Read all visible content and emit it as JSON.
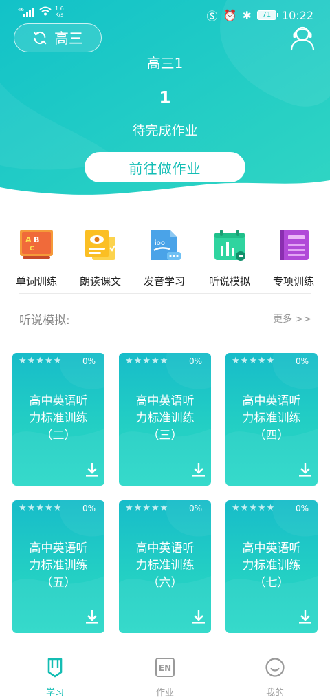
{
  "status_bar": {
    "signal": "46",
    "net_speed_value": "1.6",
    "net_speed_unit": "K/s",
    "battery": "71",
    "time": "10:22"
  },
  "header": {
    "grade_button_label": "高三",
    "class_name": "高三1",
    "pending_count": "1",
    "pending_label": "待完成作业",
    "go_button_label": "前往做作业"
  },
  "features": [
    {
      "label": "单词训练",
      "icon": "abc-board-icon"
    },
    {
      "label": "朗读课文",
      "icon": "reading-book-icon"
    },
    {
      "label": "发音学习",
      "icon": "pronunciation-doc-icon"
    },
    {
      "label": "听说模拟",
      "icon": "calendar-chart-icon"
    },
    {
      "label": "专项训练",
      "icon": "purple-book-icon"
    }
  ],
  "section": {
    "title": "听说模拟:",
    "more": "更多 >>"
  },
  "cards": [
    {
      "title": "高中英语听力标准训练（二）",
      "line1": "高中英语听",
      "line2": "力标准训练",
      "line3": "（二）",
      "progress": "0%"
    },
    {
      "title": "高中英语听力标准训练（三）",
      "line1": "高中英语听",
      "line2": "力标准训练",
      "line3": "（三）",
      "progress": "0%"
    },
    {
      "title": "高中英语听力标准训练（四）",
      "line1": "高中英语听",
      "line2": "力标准训练",
      "line3": "（四）",
      "progress": "0%"
    },
    {
      "title": "高中英语听力标准训练（五）",
      "line1": "高中英语听",
      "line2": "力标准训练",
      "line3": "（五）",
      "progress": "0%"
    },
    {
      "title": "高中英语听力标准训练（六）",
      "line1": "高中英语听",
      "line2": "力标准训练",
      "line3": "（六）",
      "progress": "0%"
    },
    {
      "title": "高中英语听力标准训练（七）",
      "line1": "高中英语听",
      "line2": "力标准训练",
      "line3": "（七）",
      "progress": "0%"
    }
  ],
  "tabs": [
    {
      "label": "学习",
      "active": true,
      "color": "#14bdb3"
    },
    {
      "label": "作业",
      "active": false,
      "color": "#9a9a9a",
      "icon_text": "EN"
    },
    {
      "label": "我的",
      "active": false,
      "color": "#9a9a9a"
    }
  ],
  "colors": {
    "accent": "#14bdb3",
    "header_gradient_start": "#10c0c6",
    "header_gradient_end": "#2fd6c4"
  }
}
